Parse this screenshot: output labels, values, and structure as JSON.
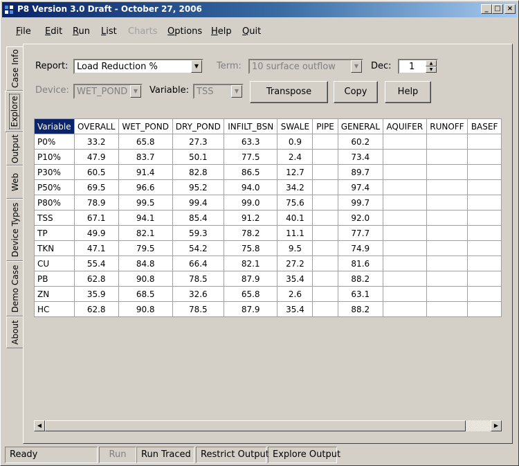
{
  "window": {
    "title": "P8 Version 3.0 Draft - October 27, 2006",
    "minimize": "_",
    "maximize": "□",
    "close": "×"
  },
  "menu": [
    {
      "first": "F",
      "rest": "ile"
    },
    {
      "first": "E",
      "rest": "dit"
    },
    {
      "first": "R",
      "rest": "un"
    },
    {
      "first": "L",
      "rest": "ist"
    },
    {
      "first": "",
      "rest": "Charts"
    },
    {
      "first": "O",
      "rest": "ptions"
    },
    {
      "first": "H",
      "rest": "elp"
    },
    {
      "first": "Q",
      "rest": "uit"
    }
  ],
  "tabs": [
    "Case Info",
    "Explore",
    "Output",
    "Web",
    "Device Types",
    "Demo Case",
    "About"
  ],
  "controls": {
    "report_label": "Report:",
    "report_value": "Load Reduction %",
    "term_label": "Term:",
    "term_value": "10 surface outflow",
    "dec_label": "Dec:",
    "dec_value": "1",
    "device_label": "Device:",
    "device_value": "WET_POND",
    "variable_label": "Variable:",
    "variable_value": "TSS",
    "transpose": "Transpose",
    "copy": "Copy",
    "help": "Help"
  },
  "grid": {
    "headers": [
      "Variable",
      "OVERALL",
      "WET_POND",
      "DRY_POND",
      "INFILT_BSN",
      "SWALE",
      "PIPE",
      "GENERAL",
      "AQUIFER",
      "RUNOFF",
      "BASEF"
    ],
    "rows": [
      [
        "P0%",
        "33.2",
        "65.8",
        "27.3",
        "63.3",
        "0.9",
        "",
        "60.2",
        "",
        "",
        ""
      ],
      [
        "P10%",
        "47.9",
        "83.7",
        "50.1",
        "77.5",
        "2.4",
        "",
        "73.4",
        "",
        "",
        ""
      ],
      [
        "P30%",
        "60.5",
        "91.4",
        "82.8",
        "86.5",
        "12.7",
        "",
        "89.7",
        "",
        "",
        ""
      ],
      [
        "P50%",
        "69.5",
        "96.6",
        "95.2",
        "94.0",
        "34.2",
        "",
        "97.4",
        "",
        "",
        ""
      ],
      [
        "P80%",
        "78.9",
        "99.5",
        "99.4",
        "99.0",
        "75.6",
        "",
        "99.7",
        "",
        "",
        ""
      ],
      [
        "TSS",
        "67.1",
        "94.1",
        "85.4",
        "91.2",
        "40.1",
        "",
        "92.0",
        "",
        "",
        ""
      ],
      [
        "TP",
        "49.9",
        "82.1",
        "59.3",
        "78.2",
        "11.1",
        "",
        "77.7",
        "",
        "",
        ""
      ],
      [
        "TKN",
        "47.1",
        "79.5",
        "54.2",
        "75.8",
        "9.5",
        "",
        "74.9",
        "",
        "",
        ""
      ],
      [
        "CU",
        "55.4",
        "84.8",
        "66.4",
        "82.1",
        "27.2",
        "",
        "81.6",
        "",
        "",
        ""
      ],
      [
        "PB",
        "62.8",
        "90.8",
        "78.5",
        "87.9",
        "35.4",
        "",
        "88.2",
        "",
        "",
        ""
      ],
      [
        "ZN",
        "35.9",
        "68.5",
        "32.6",
        "65.8",
        "2.6",
        "",
        "63.1",
        "",
        "",
        ""
      ],
      [
        "HC",
        "62.8",
        "90.8",
        "78.5",
        "87.9",
        "35.4",
        "",
        "88.2",
        "",
        "",
        ""
      ]
    ]
  },
  "status": [
    "Ready",
    "Run",
    "Run Traced",
    "Restrict Output",
    "Explore Output"
  ]
}
